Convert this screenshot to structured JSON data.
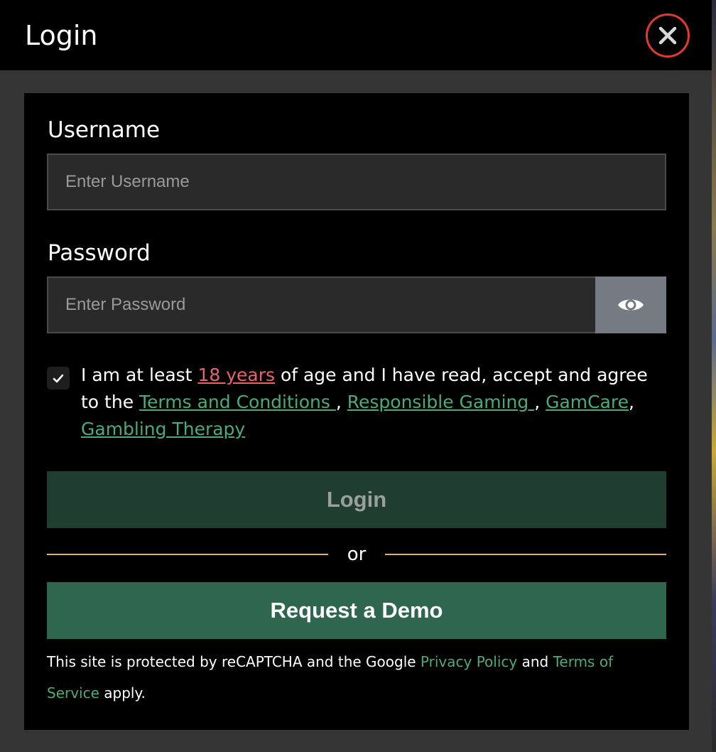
{
  "header": {
    "title": "Login"
  },
  "form": {
    "username_label": "Username",
    "username_placeholder": "Enter Username",
    "username_value": "",
    "password_label": "Password",
    "password_placeholder": "Enter Password",
    "password_value": ""
  },
  "terms": {
    "checked": true,
    "part1": "I am at least ",
    "age_link": "18 years",
    "part2": " of age and I have read, accept and agree to the ",
    "terms_link": "Terms and Conditions ",
    "sep1": ", ",
    "responsible_link": "Responsible Gaming ",
    "sep2": ", ",
    "gamcare_link": "GamCare",
    "sep3": ", ",
    "therapy_link": "Gambling Therapy"
  },
  "actions": {
    "login_label": "Login",
    "or_label": "or",
    "demo_label": "Request a Demo"
  },
  "recaptcha": {
    "part1": "This site is protected by reCAPTCHA and the Google ",
    "privacy_link": "Privacy Policy",
    "part2": " and ",
    "tos_link": "Terms of Service",
    "part3": " apply."
  },
  "colors": {
    "close_ring": "#e0392e",
    "age_link": "#e8636a",
    "link_green": "#4caa7a",
    "login_button": "#1f3d31",
    "demo_button": "#2e6650",
    "divider": "#d9b45a"
  },
  "icons": {
    "close": "close-icon",
    "eye": "eye-icon",
    "check": "checkmark-icon"
  }
}
